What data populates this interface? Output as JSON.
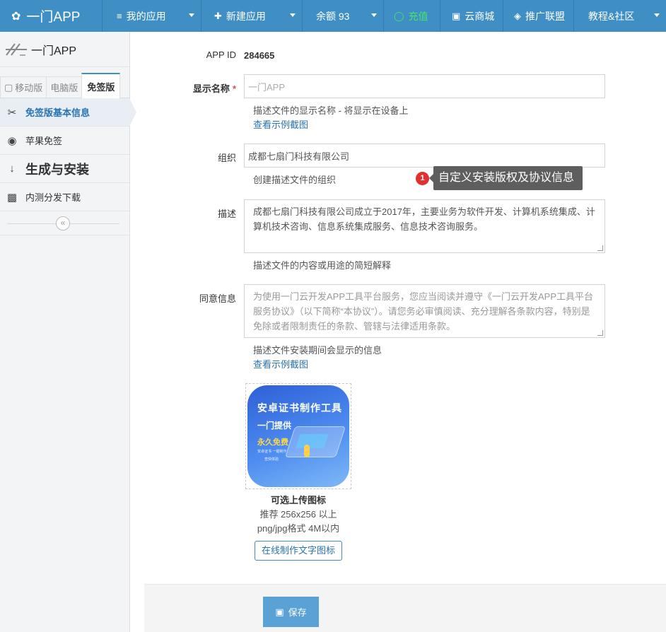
{
  "topbar": {
    "brand": "一门APP",
    "my_apps": "我的应用",
    "new_app": "新建应用",
    "balance": "余额 93",
    "recharge": "充值",
    "cloud_store": "云商城",
    "promo": "推广联盟",
    "tutorials": "教程&社区"
  },
  "sidebar": {
    "app_name": "一门APP",
    "tabs": [
      "移动版",
      "电脑版",
      "免签版"
    ],
    "active_tab": "免签版",
    "menu": [
      {
        "label": "免签版基本信息",
        "icon": "scissors-icon",
        "active": true
      },
      {
        "label": "苹果免签",
        "icon": "compass-icon"
      },
      {
        "label": "生成与安装",
        "icon": "sort-numeric-icon"
      },
      {
        "label": "内测分发下载",
        "icon": "qrcode-icon"
      }
    ],
    "collapse_glyph": "«"
  },
  "form": {
    "app_id_label": "APP ID",
    "app_id_value": "284665",
    "display_name_label": "显示名称",
    "required_mark": "*",
    "display_name_placeholder": "一门APP",
    "display_name_help": "描述文件的显示名称 - 将显示在设备上",
    "example_link": "查看示例截图",
    "org_label": "组织",
    "org_value": "成都七扇门科技有限公司",
    "org_help": "创建描述文件的组织",
    "desc_label": "描述",
    "desc_value": "成都七扇门科技有限公司成立于2017年，主要业务为软件开发、计算机系统集成、计算机技术咨询、信息系统集成服务、信息技术咨询服务。",
    "desc_help": "描述文件的内容或用途的简短解释",
    "consent_label": "同意信息",
    "consent_placeholder": "为使用一门云开发APP工具平台服务，您应当阅读并遵守《一门云开发APP工具平台服务协议》（以下简称“本协议”）。请您务必审慎阅读、充分理解各条款内容，特别是免除或者限制责任的条款、管辖与法律适用条款。",
    "consent_help": "描述文件安装期间会显示的信息",
    "example_link2": "查看示例截图"
  },
  "tooltip": {
    "badge": "1",
    "text": "自定义安装版权及协议信息"
  },
  "icon_upload": {
    "image_text_line1": "安卓证书制作工具",
    "image_text_line2": "一门提供",
    "image_text_line3": "永久免费",
    "image_text_line4": "安卓证书 一键制作",
    "image_text_line5": "查快体验",
    "caption": "可选上传图标",
    "hint_line1": "推荐 256x256 以上",
    "hint_line2": "png/jpg格式 4M以内",
    "make_button": "在线制作文字图标"
  },
  "footer": {
    "save_label": "保存"
  },
  "colors": {
    "topbar": "#3f8ec4",
    "recharge": "#44e66a",
    "link": "#2a73b0",
    "required": "#e04b4b",
    "save_button": "#5aa2d6"
  }
}
